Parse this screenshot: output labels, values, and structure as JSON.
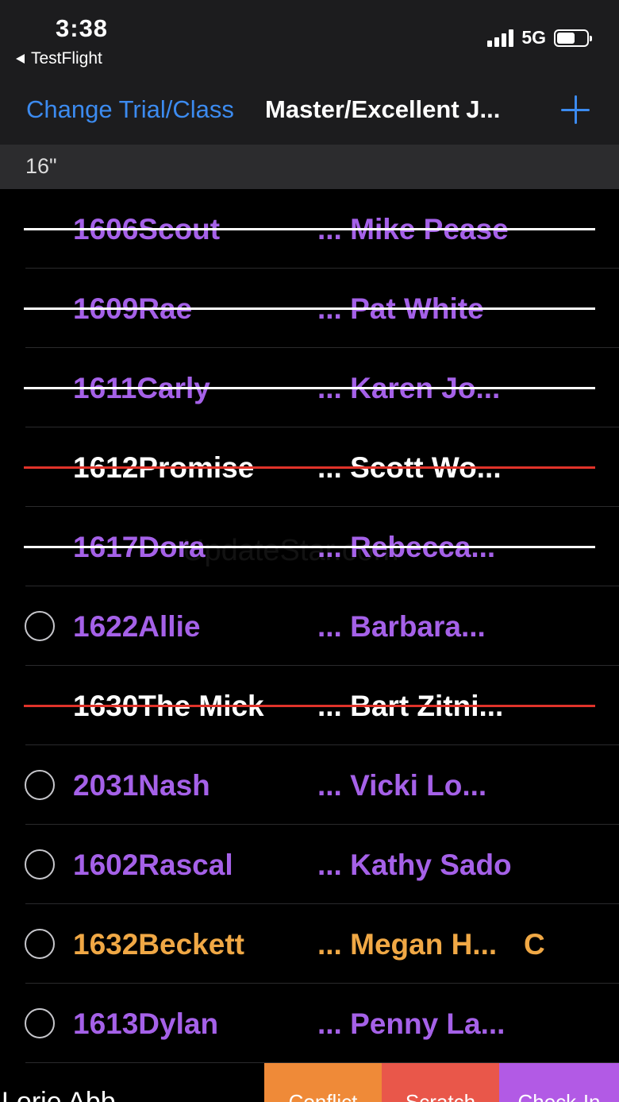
{
  "status_bar": {
    "time": "3:38",
    "back_app": "TestFlight",
    "network": "5G",
    "battery_level": 0.6
  },
  "nav": {
    "back_label": "Change Trial/Class",
    "title": "Master/Excellent J...",
    "add_icon": "plus-icon",
    "accent_color": "#3c8bf0"
  },
  "section": {
    "label": "16\""
  },
  "colors": {
    "purple": "#a561e8",
    "orange": "#f0a845",
    "white": "#ffffff",
    "strike_white": "#ffffff",
    "strike_red": "#e0332a",
    "conflict": "#ef8a38",
    "scratch": "#e9574a",
    "checkin": "#b25ae5"
  },
  "entries": [
    {
      "dog": "1606Scout",
      "handler": "... Mike Pease",
      "badge": "",
      "color": "purple",
      "strike": "white",
      "radio": false
    },
    {
      "dog": "1609Rae",
      "handler": "... Pat White",
      "badge": "",
      "color": "purple",
      "strike": "white",
      "radio": false
    },
    {
      "dog": "1611Carly",
      "handler": "...  Karen Jo...",
      "badge": "",
      "color": "purple",
      "strike": "white",
      "radio": false
    },
    {
      "dog": "1612Promise",
      "handler": "...  Scott  Wo...",
      "badge": "",
      "color": "white",
      "strike": "red",
      "radio": false
    },
    {
      "dog": "1617Dora",
      "handler": "... Rebecca...",
      "badge": "",
      "color": "purple",
      "strike": "white",
      "radio": false
    },
    {
      "dog": "1622Allie",
      "handler": "... Barbara...",
      "badge": "",
      "color": "purple",
      "strike": "",
      "radio": true
    },
    {
      "dog": "1630The Mick",
      "handler": "... Bart Zitni...",
      "badge": "",
      "color": "white",
      "strike": "red",
      "radio": false
    },
    {
      "dog": "2031Nash",
      "handler": "... Vicki Lo...",
      "badge": "",
      "color": "purple",
      "strike": "",
      "radio": true
    },
    {
      "dog": "1602Rascal",
      "handler": "... Kathy Sado",
      "badge": "",
      "color": "purple",
      "strike": "",
      "radio": true
    },
    {
      "dog": "1632Beckett",
      "handler": "... Megan H...",
      "badge": "C",
      "color": "orange",
      "strike": "",
      "radio": true
    },
    {
      "dog": "1613Dylan",
      "handler": "... Penny La...",
      "badge": "",
      "color": "purple",
      "strike": "",
      "radio": true
    }
  ],
  "bottom_row": {
    "partial_name": "Lorie Abb",
    "actions": [
      {
        "label": "Conflict",
        "color": "conflict"
      },
      {
        "label": "Scratch",
        "color": "scratch"
      },
      {
        "label": "Check-In",
        "color": "checkin"
      }
    ]
  },
  "watermark": "UpdateStar.com"
}
